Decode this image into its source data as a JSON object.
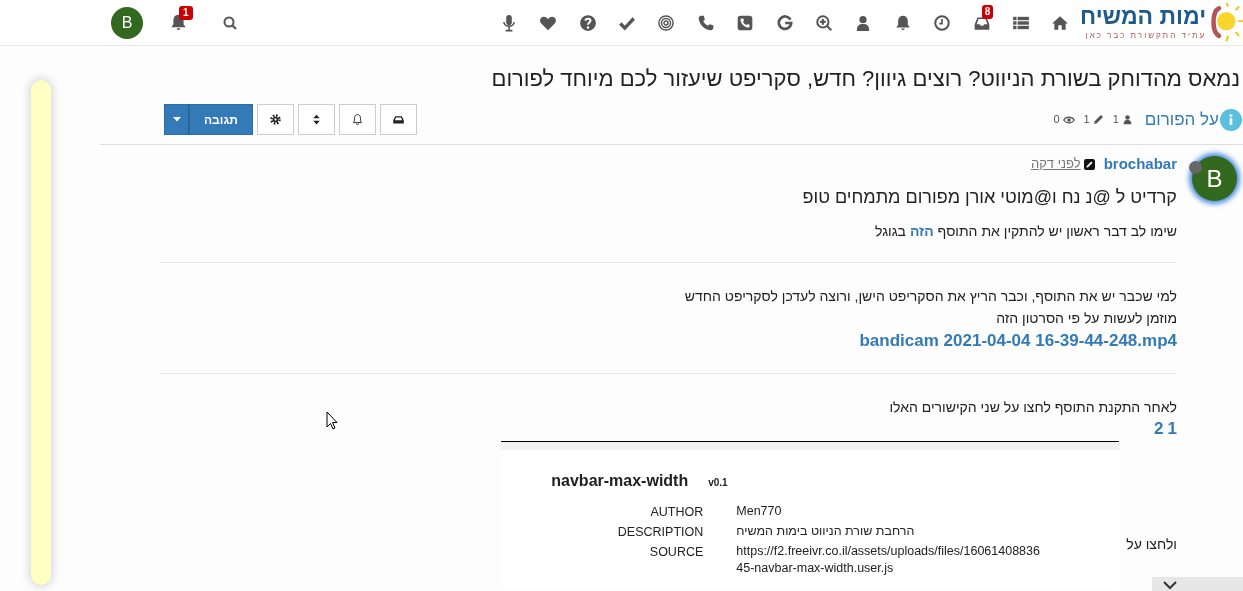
{
  "navbar": {
    "logo": {
      "title": "ימות המשיח",
      "tagline": "עתיד התקשורת כבר כאן"
    },
    "icons": [
      {
        "kind": "home"
      },
      {
        "kind": "list"
      },
      {
        "kind": "inbox",
        "badge": "8"
      },
      {
        "kind": "clock"
      },
      {
        "kind": "bell"
      },
      {
        "kind": "user"
      },
      {
        "kind": "zoom"
      },
      {
        "kind": "google"
      },
      {
        "kind": "phone-square"
      },
      {
        "kind": "phone"
      },
      {
        "kind": "target"
      },
      {
        "kind": "check"
      },
      {
        "kind": "question"
      },
      {
        "kind": "heart"
      },
      {
        "kind": "mic"
      }
    ],
    "user_avatar": "B",
    "notifications_badge": "1"
  },
  "topic": {
    "title": "נמאס מהדוחק בשורת הניווט? רוצים גיוון? חדש, סקריפט שיעזור לכם מיוחד לפורום",
    "category": "על הפורום",
    "stats": [
      {
        "kind": "posters",
        "value": "1"
      },
      {
        "kind": "posts",
        "value": "1"
      },
      {
        "kind": "views",
        "value": "0"
      }
    ],
    "tools": [
      {
        "kind": "inbox"
      },
      {
        "kind": "bell"
      },
      {
        "kind": "sort"
      },
      {
        "kind": "gear"
      }
    ],
    "reply_button": "תגובה"
  },
  "post": {
    "avatar": "B",
    "online": false,
    "author": "brochabar",
    "time": "לפני דקה",
    "blocks": [
      {
        "kind": "heading",
        "text": "קרדיט ל @נ נח ו@מוטי אורן מפורום מתמחים טופ"
      },
      {
        "kind": "paragraph",
        "parts": [
          {
            "text": "שימו לב דבר ראשון יש להתקין את התוסף "
          },
          {
            "text": "הזה",
            "link": true
          },
          {
            "text": " בגוגל"
          }
        ]
      },
      {
        "kind": "hr"
      },
      {
        "kind": "paragraph",
        "parts": [
          {
            "text": "למי שכבר יש את התוסף, וכבר הריץ את הסקריפט הישן, ורוצה לעדכן לסקריפט החדש"
          }
        ]
      },
      {
        "kind": "paragraph",
        "parts": [
          {
            "text": "מוזמן לעשות על פי הסרטון הזה"
          }
        ]
      },
      {
        "kind": "file_link",
        "text": "bandicam 2021-04-04 16-39-44-248.mp4"
      },
      {
        "kind": "hr"
      },
      {
        "kind": "paragraph",
        "parts": [
          {
            "text": "לאחר התקנת התוסף לחצו על שני הקישורים האלו"
          }
        ]
      },
      {
        "kind": "links",
        "items": [
          "1",
          "2"
        ]
      },
      {
        "kind": "screenshot",
        "caption": "ולחצו על",
        "name": "navbar-max-width",
        "version": "v0.1",
        "rows": [
          {
            "label": "AUTHOR",
            "value": "Men770"
          },
          {
            "label": "DESCRIPTION",
            "value": "הרחבת שורת הניווט בימות המשיח"
          },
          {
            "label": "SOURCE",
            "value": "https://f2.freeivr.co.il/assets/uploads/files/1606140883645-navbar-max-width.user.js"
          }
        ]
      }
    ]
  }
}
